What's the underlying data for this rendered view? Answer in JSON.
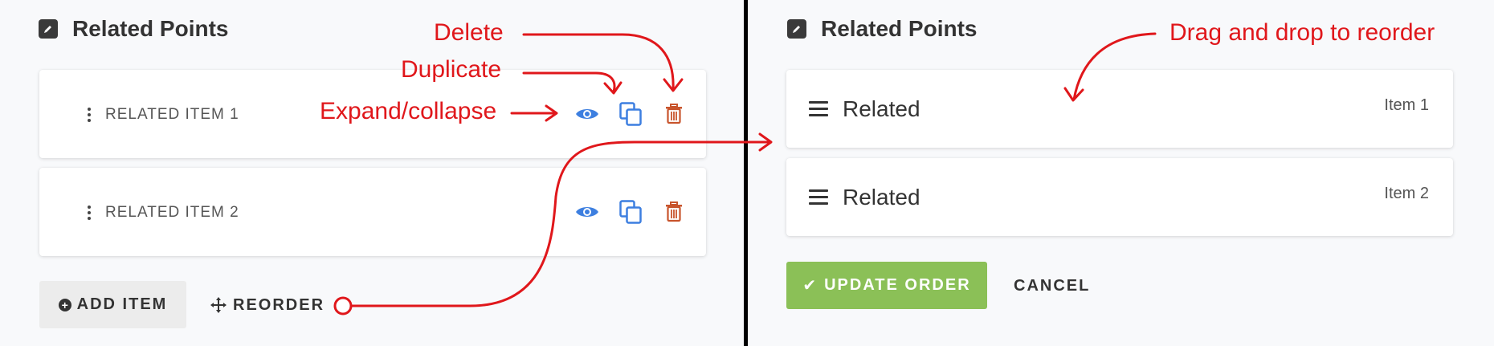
{
  "left_panel": {
    "title": "Related Points",
    "items": [
      {
        "label": "RELATED ITEM 1"
      },
      {
        "label": "RELATED ITEM 2"
      }
    ],
    "add_button_label": "ADD ITEM",
    "reorder_button_label": "REORDER"
  },
  "right_panel": {
    "title": "Related Points",
    "items": [
      {
        "label": "Related",
        "sublabel": "Item 1"
      },
      {
        "label": "Related",
        "sublabel": "Item 2"
      }
    ],
    "update_button_label": "UPDATE ORDER",
    "cancel_button_label": "CANCEL"
  },
  "annotations": {
    "delete": "Delete",
    "duplicate": "Duplicate",
    "expand_collapse": "Expand/collapse",
    "drag_drop": "Drag and drop to reorder"
  },
  "colors": {
    "annotation": "#e0171b",
    "eye_icon": "#3d7fe0",
    "copy_icon": "#3d7fe0",
    "trash_icon": "#c8542c",
    "update_button": "#8bc057",
    "divider": "#000000"
  },
  "icons": [
    "edit-icon",
    "kebab-icon",
    "eye-icon",
    "copy-icon",
    "trash-icon",
    "plus-circle-icon",
    "move-icon",
    "hamburger-icon",
    "check-icon"
  ]
}
